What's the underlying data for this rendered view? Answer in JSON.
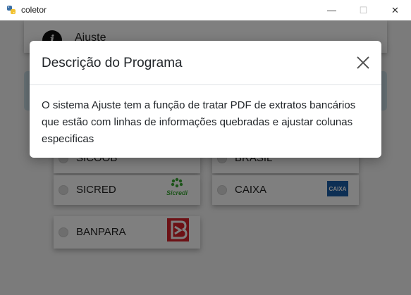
{
  "window": {
    "title": "coletor",
    "minimize_symbol": "—",
    "maximize_symbol": "☐",
    "close_symbol": "✕"
  },
  "header": {
    "title": "Ajuste",
    "icon": "info-icon"
  },
  "banks": [
    {
      "name": "SICOOB",
      "selected": false
    },
    {
      "name": "BRASIL",
      "selected": false
    },
    {
      "name": "SICRED",
      "selected": false,
      "logo": "sicredi-logo",
      "logo_text": "Sicredi"
    },
    {
      "name": "CAIXA",
      "selected": false,
      "logo": "caixa-logo",
      "logo_text": "CAIXA"
    },
    {
      "name": "BANPARA",
      "selected": false,
      "logo": "banpara-logo"
    }
  ],
  "modal": {
    "title": "Descrição do Programa",
    "body": "O sistema Ajuste tem a função de tratar PDF de extratos bancários que estão com linhas de informações quebradas e ajustar colunas especificas",
    "close_icon": "close-icon"
  },
  "colors": {
    "overlay": "#000000",
    "info_strip": "#cfe2ea",
    "caixa_blue": "#1b5fa8",
    "banpara_red": "#d8232a",
    "sicredi_green": "#3aa935"
  }
}
